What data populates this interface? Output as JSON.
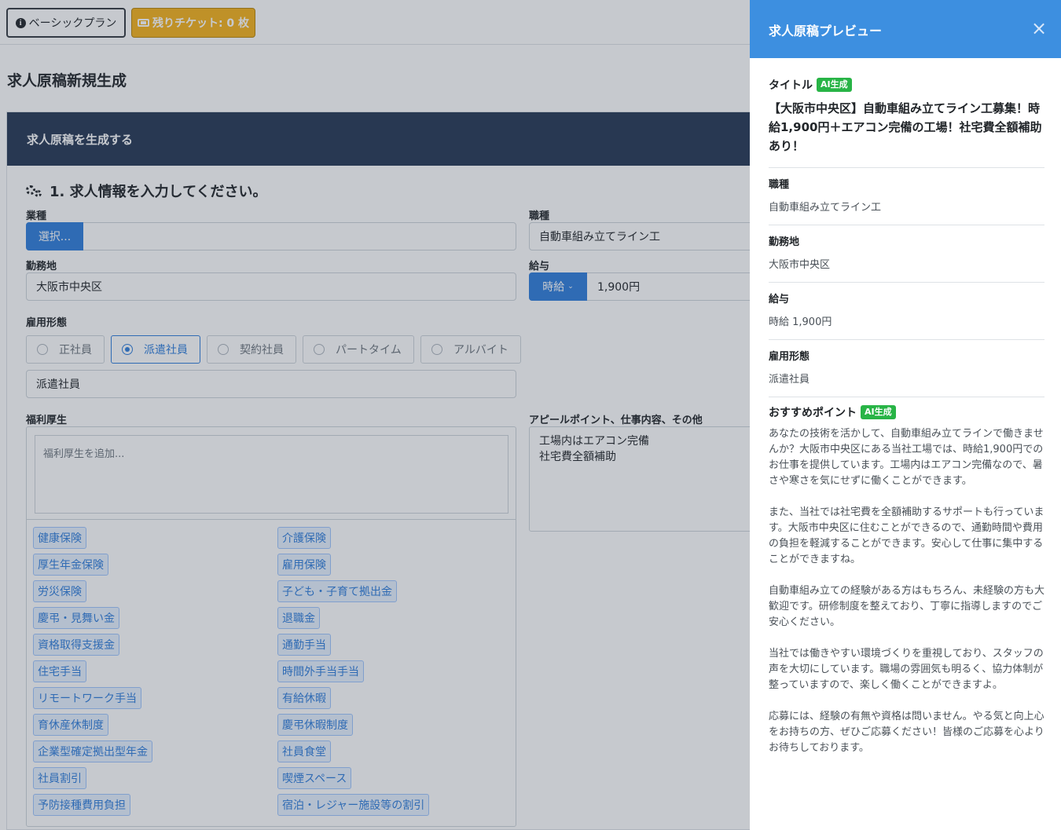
{
  "topbar": {
    "plan_label": "ベーシックプラン",
    "ticket_label": "残りチケット: 0 枚"
  },
  "page_title": "求人原稿新規生成",
  "card": {
    "header": "求人原稿を生成する",
    "section_title": "1. 求人情報を入力してください。"
  },
  "form": {
    "industry": {
      "label": "業種",
      "select_button": "選択..."
    },
    "job_type": {
      "label": "職種",
      "value": "自動車組み立てライン工"
    },
    "location": {
      "label": "勤務地",
      "value": "大阪市中央区"
    },
    "salary": {
      "label": "給与",
      "type": "時給",
      "value": "1,900円"
    },
    "employment": {
      "label": "雇用形態",
      "options": [
        "正社員",
        "派遣社員",
        "契約社員",
        "パートタイム",
        "アルバイト"
      ],
      "selected": "派遣社員",
      "value": "派遣社員"
    },
    "benefits": {
      "label": "福利厚生",
      "placeholder": "福利厚生を追加...",
      "tags_left": [
        "健康保険",
        "厚生年金保険",
        "労災保険",
        "慶弔・見舞い金",
        "資格取得支援金",
        "住宅手当",
        "リモートワーク手当",
        "育休産休制度",
        "企業型確定拠出型年金",
        "社員割引",
        "予防接種費用負担"
      ],
      "tags_right": [
        "介護保険",
        "雇用保険",
        "子ども・子育て拠出金",
        "退職金",
        "通勤手当",
        "時間外手当手当",
        "有給休暇",
        "慶弔休暇制度",
        "社員食堂",
        "喫煙スペース",
        "宿泊・レジャー施設等の割引"
      ]
    },
    "appeal": {
      "label": "アピールポイント、仕事内容、その他",
      "lines": [
        "工場内はエアコン完備",
        "社宅費全額補助"
      ]
    }
  },
  "preview": {
    "header": "求人原稿プレビュー",
    "close_glyph": "×",
    "ai_badge": "AI生成",
    "title_label": "タイトル",
    "title_value": "【大阪市中央区】自動車組み立てライン工募集！時給1,900円＋エアコン完備の工場！社宅費全額補助あり！",
    "job_label": "職種",
    "job_value": "自動車組み立てライン工",
    "location_label": "勤務地",
    "location_value": "大阪市中央区",
    "salary_label": "給与",
    "salary_value": "時給 1,900円",
    "employment_label": "雇用形態",
    "employment_value": "派遣社員",
    "points_label": "おすすめポイント",
    "points_paragraphs": [
      "あなたの技術を活かして、自動車組み立てラインで働きませんか？大阪市中央区にある当社工場では、時給1,900円でのお仕事を提供しています。工場内はエアコン完備なので、暑さや寒さを気にせずに働くことができます。",
      "また、当社では社宅費を全額補助するサポートも行っています。大阪市中央区に住むことができるので、通勤時間や費用の負担を軽減することができます。安心して仕事に集中することができますね。",
      "自動車組み立ての経験がある方はもちろん、未経験の方も大歓迎です。研修制度を整えており、丁寧に指導しますのでご安心ください。",
      "当社では働きやすい環境づくりを重視しており、スタッフの声を大切にしています。職場の雰囲気も明るく、協力体制が整っていますので、楽しく働くことができますよ。",
      "応募には、経験の有無や資格は問いません。やる気と向上心をお持ちの方、ぜひご応募ください！皆様のご応募を心よりお待ちしております。"
    ]
  }
}
